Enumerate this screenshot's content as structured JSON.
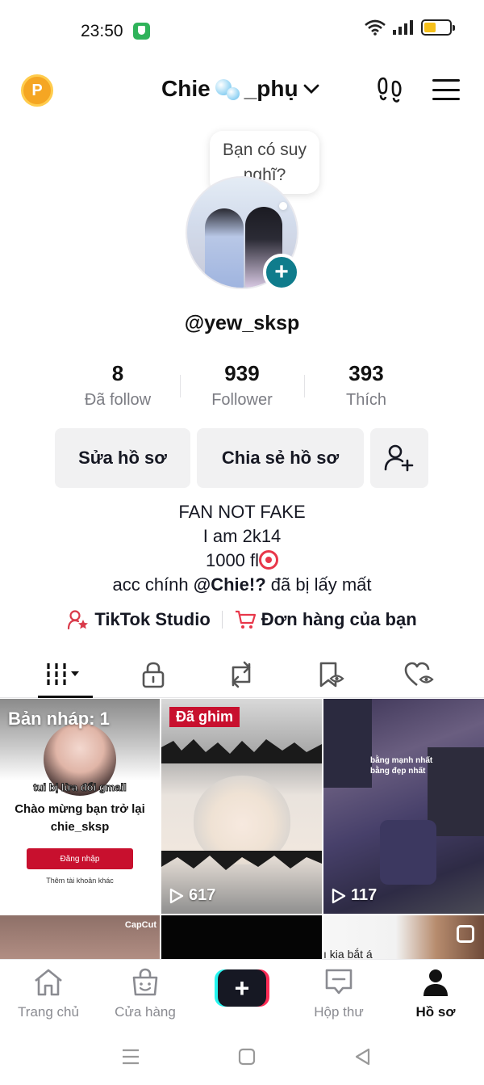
{
  "status_bar": {
    "time": "23:50",
    "battery_level": 0.45,
    "icons": [
      "shield-icon",
      "wifi-icon",
      "signal-icon",
      "battery-icon"
    ]
  },
  "header": {
    "coin_icon_letter": "P",
    "display_name_part1": "Chie",
    "display_name_part2": "_phụ",
    "icons": [
      "footprints-icon",
      "menu-icon"
    ]
  },
  "profile": {
    "thought_bubble": "Bạn có suy nghĩ?",
    "username": "@yew_sksp",
    "stats": [
      {
        "value": "8",
        "label": "Đã follow"
      },
      {
        "value": "939",
        "label": "Follower"
      },
      {
        "value": "393",
        "label": "Thích"
      }
    ],
    "buttons": {
      "edit": "Sửa hồ sơ",
      "share": "Chia sẻ hồ sơ"
    },
    "bio": {
      "line1": "FAN NOT FAKE",
      "line2": "I am 2k14",
      "line3": "1000 fl",
      "line4_prefix": "acc chính ",
      "line4_mention": "@Chie!?",
      "line4_suffix": " đã bị lấy mất"
    },
    "links": {
      "studio": "TikTok Studio",
      "orders": "Đơn hàng của bạn"
    }
  },
  "tabs": [
    "grid-icon",
    "lock-icon",
    "repost-icon",
    "bookmark-icon",
    "liked-icon"
  ],
  "grid": {
    "draft_label": "Bản nháp: 1",
    "draft_small_text": "tui bị lừa đổi gmail",
    "draft_welcome_line1": "Chào mừng bạn trở lại",
    "draft_welcome_line2": "chie_sksp",
    "draft_login": "Đăng nhập",
    "draft_other": "Thêm tài khoản khác",
    "pinned_label": "Đã ghim",
    "video2_views": "617",
    "video3_views": "117",
    "video3_caption1": "bằng mạnh nhất",
    "video3_caption2": "bằng đẹp nhất",
    "capcut_label": "CapCut",
    "video6_text": "ı kia bắt á"
  },
  "bottom_nav": [
    {
      "label": "Trang chủ",
      "icon": "home-icon"
    },
    {
      "label": "Cửa hàng",
      "icon": "shop-icon"
    },
    {
      "label": "",
      "icon": "create-plus-icon"
    },
    {
      "label": "Hộp thư",
      "icon": "inbox-icon"
    },
    {
      "label": "Hồ sơ",
      "icon": "profile-icon"
    }
  ],
  "colors": {
    "accent_red": "#fe2c55",
    "accent_cyan": "#25f4ee",
    "teal_plus": "#0f7c8c",
    "pinned_red": "#c8102e"
  }
}
